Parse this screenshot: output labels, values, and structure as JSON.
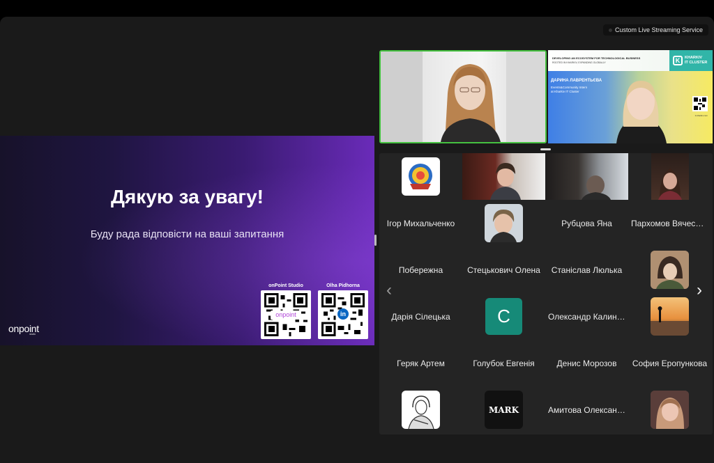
{
  "streaming": {
    "label": "Custom Live Streaming Service"
  },
  "slide": {
    "title": "Дякую за увагу!",
    "subtitle": "Буду рада відповісти на ваші запитання",
    "brand": "onpoint",
    "brand_sub": "studio",
    "qr_left_caption": "onPoint Studio",
    "qr_left_badge": "onpoint",
    "qr_right_caption": "Olha Pidhorna",
    "qr_right_badge": "in",
    "accent": "#6a2bb9"
  },
  "top_videos": {
    "speaker_border": "#45c240",
    "banner_line1": "DEVELOPING AN ECOSYSTEM FOR TECHNOLOGICAL BUSINESS",
    "banner_line2": "ROOTED IN KHARKIV, EXPANDING GLOBALLY",
    "logo_line1": "KHARKIV",
    "logo_line2": "IT CLUSTER",
    "logo_letter": "K",
    "name": "ДАРИНА ЛАВРЕНТЬЄВА",
    "role_line1": "Events&Community Intern",
    "role_line2": "at Kharkiv IT Cluster",
    "site": "it-kharkiv.com"
  },
  "gallery": {
    "participants": [
      "Ігор Михальченко",
      "Рубцова Яна",
      "Пархомов Вячеслав",
      "Побережна",
      "Стецькович Олена",
      "Станіслав Люлька",
      "Дарія Сілецька",
      "Олександр Калиниченко",
      "Геряк Артем",
      "Голубок Евгенія",
      "Денис Морозов",
      "София Еропункова",
      "Амитова Олександра"
    ],
    "letter_avatar": "C",
    "mark_avatar": "MARK",
    "prev_arrow": "‹",
    "next_arrow": "›"
  }
}
